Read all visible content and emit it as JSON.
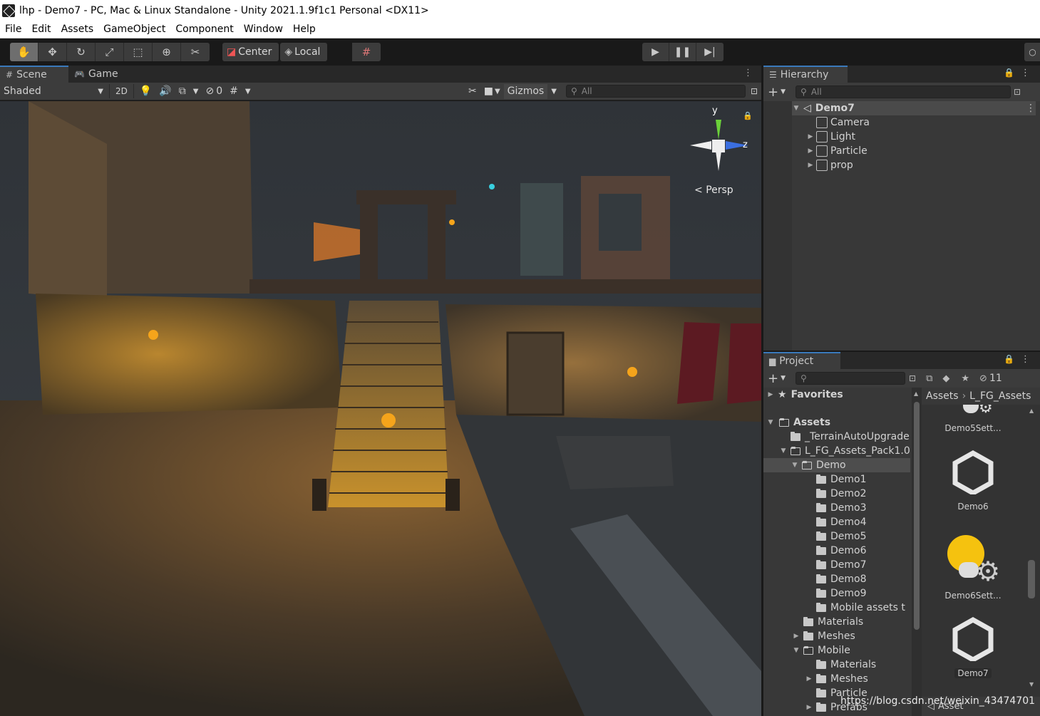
{
  "window": {
    "title": "lhp - Demo7 - PC, Mac & Linux Standalone - Unity 2021.1.9f1c1 Personal <DX11>"
  },
  "menu": [
    "File",
    "Edit",
    "Assets",
    "GameObject",
    "Component",
    "Window",
    "Help"
  ],
  "toolbar": {
    "tools": [
      "hand-tool-icon",
      "move-tool-icon",
      "rotate-tool-icon",
      "scale-tool-icon",
      "rect-tool-icon",
      "transform-tool-icon",
      "custom-tool-icon"
    ],
    "pivot_label": "Center",
    "space_label": "Local"
  },
  "scene": {
    "tabs": {
      "scene": "Scene",
      "game": "Game"
    },
    "draw_mode": "Shaded",
    "mode_2d": "2D",
    "hidden_count": "0",
    "gizmos_label": "Gizmos",
    "search_placeholder": "All",
    "persp_label": "Persp",
    "axis_y": "y",
    "axis_z": "z"
  },
  "hierarchy": {
    "tab": "Hierarchy",
    "search_placeholder": "All",
    "scene_name": "Demo7",
    "items": [
      "Camera",
      "Light",
      "Particle",
      "prop"
    ]
  },
  "project": {
    "tab": "Project",
    "hidden_count": "11",
    "favorites": "Favorites",
    "assets_root": "Assets",
    "tree": {
      "terrain": "_TerrainAutoUpgrade",
      "pack": "L_FG_Assets_Pack1.0",
      "demo": "Demo",
      "demos": [
        "Demo1",
        "Demo2",
        "Demo3",
        "Demo4",
        "Demo5",
        "Demo6",
        "Demo7",
        "Demo8",
        "Demo9",
        "Mobile assets t"
      ],
      "materials": "Materials",
      "meshes": "Meshes",
      "mobile": "Mobile",
      "mobile_children": [
        "Materials",
        "Meshes",
        "Particle",
        "Prefabs"
      ]
    },
    "breadcrumb": [
      "Assets",
      "L_FG_Assets"
    ],
    "tiles": [
      "Demo5Sett...",
      "Demo6",
      "Demo6Sett...",
      "Demo7"
    ],
    "footer": "Asset",
    "watermark": "https://blog.csdn.net/weixin_43474701"
  }
}
